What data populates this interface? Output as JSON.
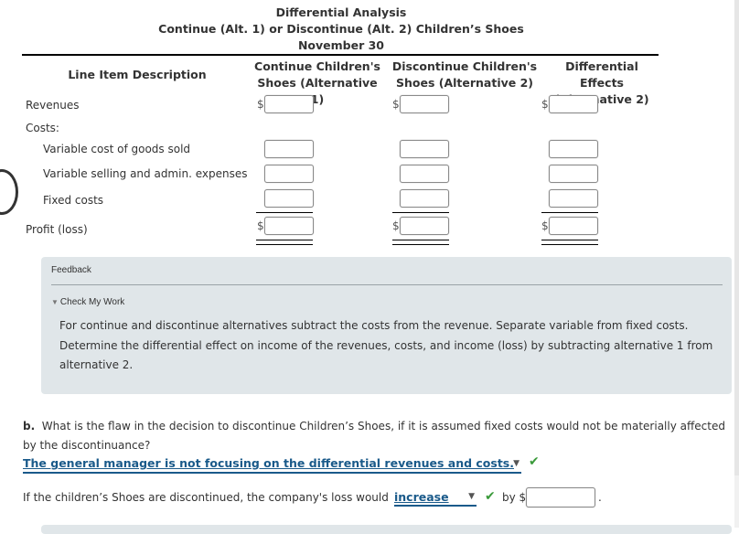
{
  "header": {
    "title": "Differential Analysis",
    "subtitle": "Continue (Alt. 1) or Discontinue (Alt. 2) Children’s Shoes",
    "date": "November 30"
  },
  "table": {
    "columns": [
      {
        "line1": "Line Item Description",
        "line2": ""
      },
      {
        "line1": "Continue Children's",
        "line2": "Shoes (Alternative 1)"
      },
      {
        "line1": "Discontinue Children's",
        "line2": "Shoes (Alternative 2)"
      },
      {
        "line1": "Differential Effects",
        "line2": "(Alternative 2)"
      }
    ],
    "currency_symbol": "$",
    "rows": [
      {
        "label": "Revenues",
        "values": [
          "",
          "",
          ""
        ]
      },
      {
        "label": "Costs:"
      },
      {
        "label": "Variable cost of goods sold",
        "values": [
          "",
          "",
          ""
        ]
      },
      {
        "label": "Variable selling and admin. expenses",
        "values": [
          "",
          "",
          ""
        ]
      },
      {
        "label": "Fixed costs",
        "values": [
          "",
          "",
          ""
        ]
      },
      {
        "label": "Profit (loss)",
        "values": [
          "",
          "",
          ""
        ]
      }
    ]
  },
  "feedback": {
    "title": "Feedback",
    "check_label": "Check My Work",
    "text": "For continue and discontinue alternatives subtract the costs from the revenue. Separate variable from fixed costs. Determine the differential effect on income of the revenues, costs, and income (loss) by subtracting alternative 1 from alternative 2."
  },
  "question_b": {
    "prefix": "b.",
    "text": "What is the flaw in the decision to discontinue Children’s Shoes, if it is assumed fixed costs would not be materially affected by the discontinuance?",
    "answer": "The general manager is not focusing on the differential revenues and costs.",
    "answer_status": "correct",
    "sentence": "If the children’s Shoes are discontinued, the company's loss would",
    "loss_direction": "increase",
    "loss_direction_status": "correct",
    "by_label": "by $",
    "loss_amount": "",
    "period": "."
  },
  "icons": {
    "checkmark": "✔",
    "caret": "▼",
    "triangle": "▼"
  },
  "colors": {
    "feedback_bg": "#e0e6e9",
    "select_blue": "#1a5a8a",
    "check_green": "#3a9a3a"
  }
}
